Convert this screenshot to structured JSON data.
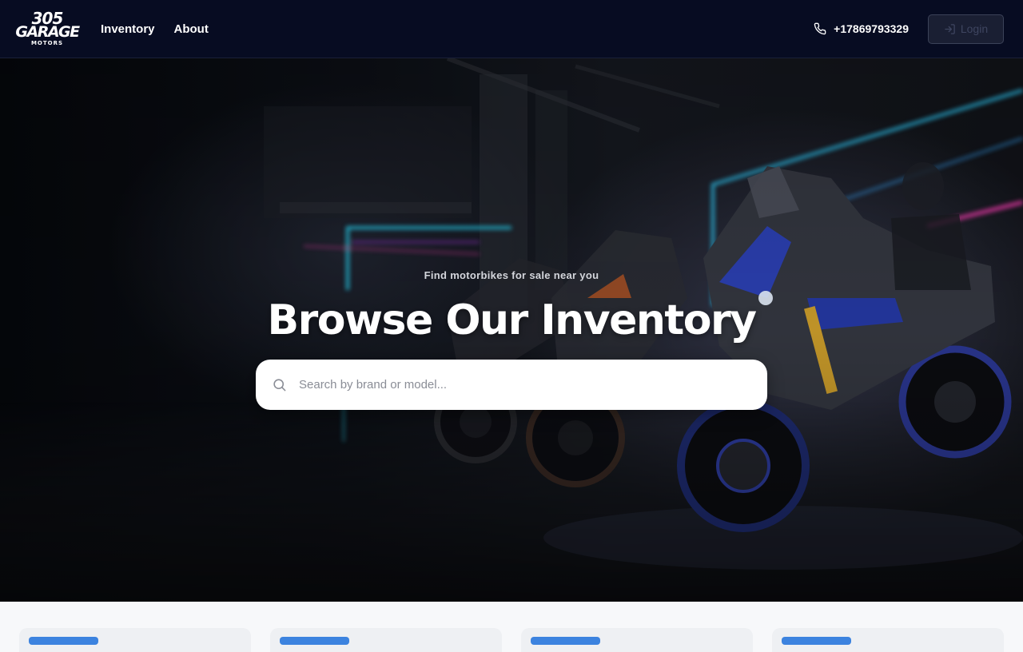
{
  "brand": {
    "logo_line1": "305",
    "logo_line2": "GARAGE",
    "logo_line3": "MOTORS"
  },
  "nav": {
    "items": [
      {
        "label": "Inventory"
      },
      {
        "label": "About"
      }
    ]
  },
  "contact": {
    "phone": "+17869793329",
    "icon": "phone-icon"
  },
  "auth": {
    "login_label": "Login",
    "login_icon": "log-in-icon"
  },
  "hero": {
    "subtitle": "Find motorbikes for sale near you",
    "title": "Browse Our Inventory",
    "search": {
      "placeholder": "Search by brand or model...",
      "value": "",
      "icon": "search-icon"
    }
  },
  "colors": {
    "header_bg": "#070c22",
    "accent": "#3c83df",
    "page_bg": "#f7f8fa"
  },
  "listing_cards": {
    "visible_count": 4
  }
}
